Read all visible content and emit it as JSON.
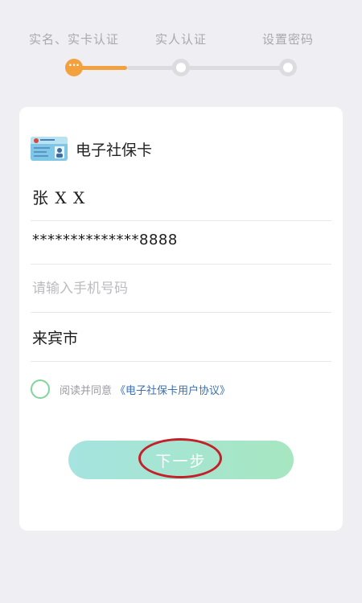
{
  "stepper": {
    "steps": [
      {
        "label": "实名、实卡认证",
        "state": "active",
        "marker": "···"
      },
      {
        "label": "实人认证",
        "state": "pending"
      },
      {
        "label": "设置密码",
        "state": "pending"
      }
    ]
  },
  "card": {
    "title": "电子社保卡",
    "icon": "social-security-card-icon",
    "name_value": "张 X X",
    "id_value": "**************8888",
    "phone_placeholder": "请输入手机号码",
    "city_value": "来宾市"
  },
  "agreement": {
    "text": "阅读并同意",
    "link": "《电子社保卡用户协议》",
    "checked": false
  },
  "next_button": {
    "label": "下一步"
  },
  "colors": {
    "accent": "#f3a13f",
    "background": "#efeef3",
    "link": "#3c6fb0",
    "button_start": "#a5e4e0",
    "button_end": "#a6e6c0",
    "check_border": "#7fd59a",
    "annotation": "#c4202a"
  }
}
